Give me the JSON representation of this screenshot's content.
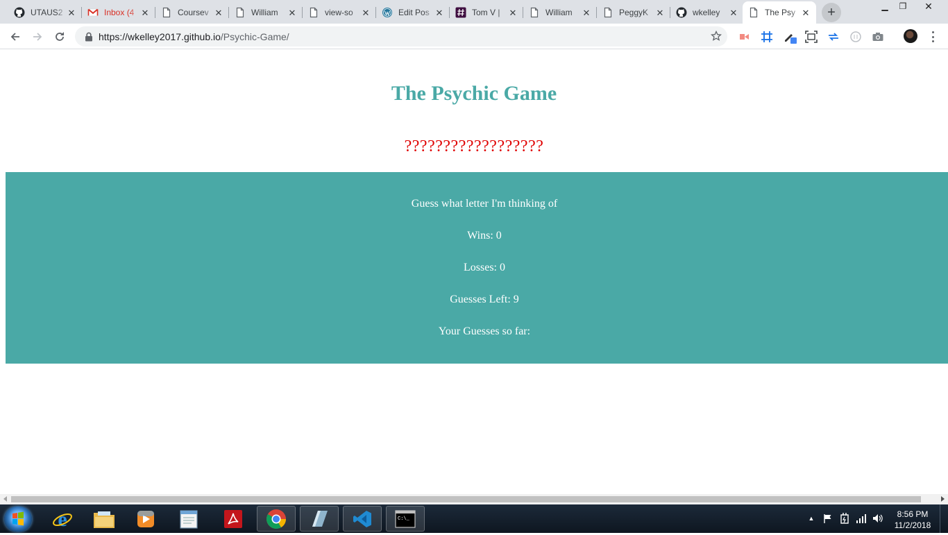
{
  "browser": {
    "tabs": [
      {
        "title": "UTAUS2",
        "icon": "github-icon"
      },
      {
        "title": "Inbox (4",
        "icon": "gmail-icon"
      },
      {
        "title": "Coursev",
        "icon": "document-icon"
      },
      {
        "title": "William",
        "icon": "document-icon"
      },
      {
        "title": "view-so",
        "icon": "document-icon"
      },
      {
        "title": "Edit Pos",
        "icon": "wordpress-icon"
      },
      {
        "title": "Tom V |",
        "icon": "slack-hash-icon"
      },
      {
        "title": "William",
        "icon": "document-icon"
      },
      {
        "title": "PeggyK",
        "icon": "document-icon"
      },
      {
        "title": "wkelley",
        "icon": "github-icon"
      },
      {
        "title": "The Psy",
        "icon": "document-icon",
        "active": true
      }
    ],
    "url_host": "https://wkelley2017.github.io",
    "url_path": "/Psychic-Game/",
    "new_tab_glyph": "+",
    "close_glyph": "✕",
    "window_controls": {
      "minimize": "▁",
      "restore": "❐",
      "close": "✕"
    }
  },
  "page": {
    "title": "The Psychic Game",
    "mystery": "??????????????????",
    "lines": [
      "Guess what letter I'm thinking of",
      "Wins: 0",
      "Losses: 0",
      "Guesses Left: 9",
      "Your Guesses so far:"
    ]
  },
  "taskbar": {
    "time": "8:56 PM",
    "date": "11/2/2018",
    "tray_expand": "▲",
    "apps": [
      "internet-explorer-icon",
      "file-explorer-icon",
      "media-player-icon",
      "notepad-icon",
      "adobe-acrobat-icon",
      "chrome-icon",
      "app-icon",
      "vscode-icon",
      "command-prompt-icon"
    ]
  },
  "colors": {
    "accent": "#4aa9a6",
    "mystery": "#e00000"
  }
}
